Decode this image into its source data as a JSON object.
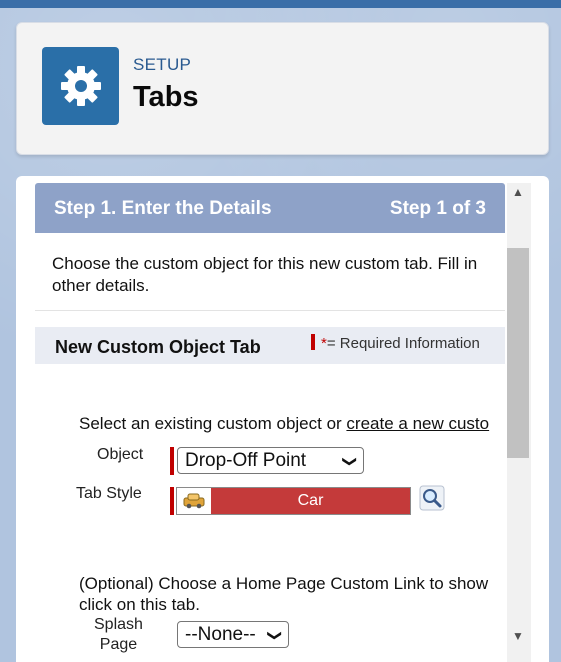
{
  "header": {
    "kicker": "SETUP",
    "title": "Tabs",
    "icon": "gear-icon",
    "icon_color": "#2a6fa8"
  },
  "step_bar": {
    "left": "Step 1. Enter the Details",
    "right": "Step 1 of 3",
    "color": "#8ea2c8"
  },
  "intro": {
    "text": "Choose the custom object for this new custom tab. Fill in other details."
  },
  "section": {
    "title": "New Custom Object Tab",
    "required_star": "*",
    "required_text": "= Required Information"
  },
  "select_line": {
    "prefix": "Select an existing custom object or ",
    "link": "create a new custo"
  },
  "fields": {
    "object_label": "Object",
    "object_value": "Drop-Off Point",
    "tab_style_label": "Tab Style",
    "tab_style_value": "Car",
    "tab_style_color": "#c43a3a",
    "optional_text": "(Optional) Choose a Home Page Custom Link to show click on this tab.",
    "splash_label_1": "Splash",
    "splash_label_2": "Page",
    "splash_value": "--None--"
  }
}
